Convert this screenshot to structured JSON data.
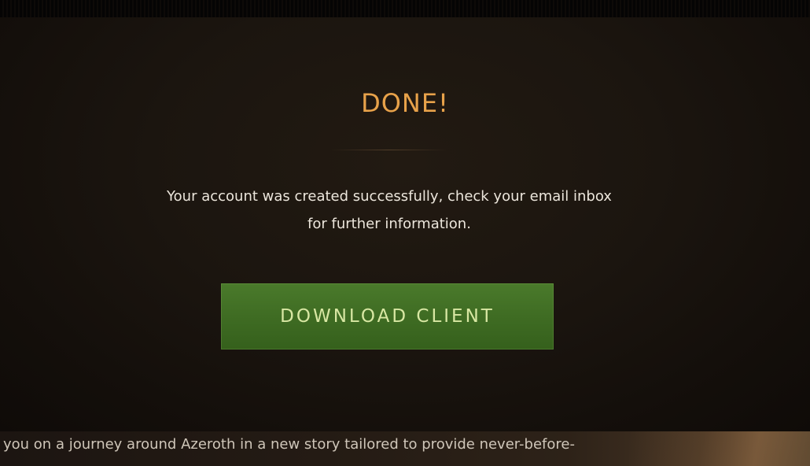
{
  "dialog": {
    "title": "DONE!",
    "message_line_1": "Your account was created successfully, check your email inbox",
    "message_line_2": "for further information.",
    "download_button_label": "DOWNLOAD CLIENT"
  },
  "footer": {
    "text": "you on a journey around Azeroth in a new story tailored to provide never-before-"
  },
  "colors": {
    "title": "#e8a24a",
    "message": "#ece6dc",
    "button_background": "#3f6c23",
    "button_text": "#d8e7a3",
    "panel_background": "#1b150f"
  }
}
